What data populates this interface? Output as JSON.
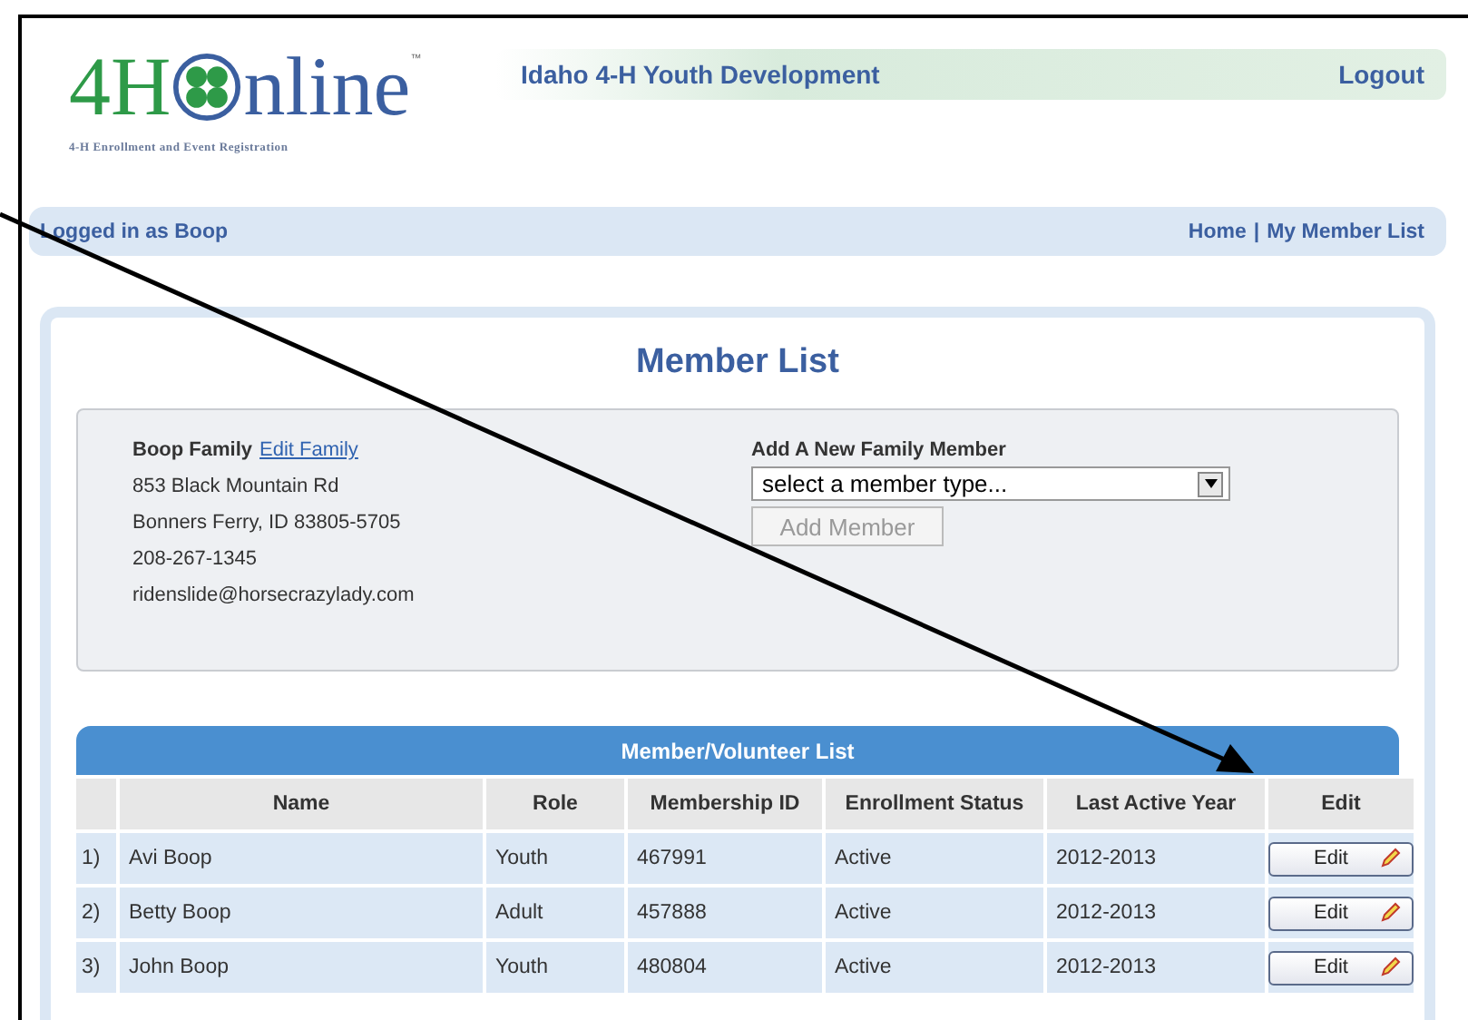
{
  "logo": {
    "lead": "4H",
    "tail": "nline",
    "mark": "™",
    "tagline": "4-H Enrollment and Event Registration"
  },
  "header": {
    "title": "Idaho 4-H Youth Development",
    "logout": "Logout"
  },
  "userbar": {
    "logged_in": "Logged in as Boop",
    "links": [
      "Home",
      "My Member List"
    ],
    "separator": "|"
  },
  "page_title": "Member List",
  "family": {
    "name": "Boop Family",
    "edit_link": "Edit Family",
    "lines": [
      "853 Black Mountain Rd",
      "Bonners Ferry, ID 83805-5705",
      "208-267-1345",
      "ridenslide@horsecrazylady.com"
    ]
  },
  "add_member": {
    "label": "Add A New Family Member",
    "select_value": "select a member type...",
    "button": "Add Member",
    "button_disabled": true
  },
  "table": {
    "title": "Member/Volunteer List",
    "columns": [
      "Name",
      "Role",
      "Membership ID",
      "Enrollment Status",
      "Last Active Year",
      "Edit"
    ],
    "rows": [
      {
        "number": "1)",
        "name": "Avi Boop",
        "role": "Youth",
        "id": "467991",
        "status": "Active",
        "year": "2012-2013",
        "edit": "Edit"
      },
      {
        "number": "2)",
        "name": "Betty Boop",
        "role": "Adult",
        "id": "457888",
        "status": "Active",
        "year": "2012-2013",
        "edit": "Edit"
      },
      {
        "number": "3)",
        "name": "John Boop",
        "role": "Youth",
        "id": "480804",
        "status": "Active",
        "year": "2012-2013",
        "edit": "Edit"
      }
    ]
  }
}
